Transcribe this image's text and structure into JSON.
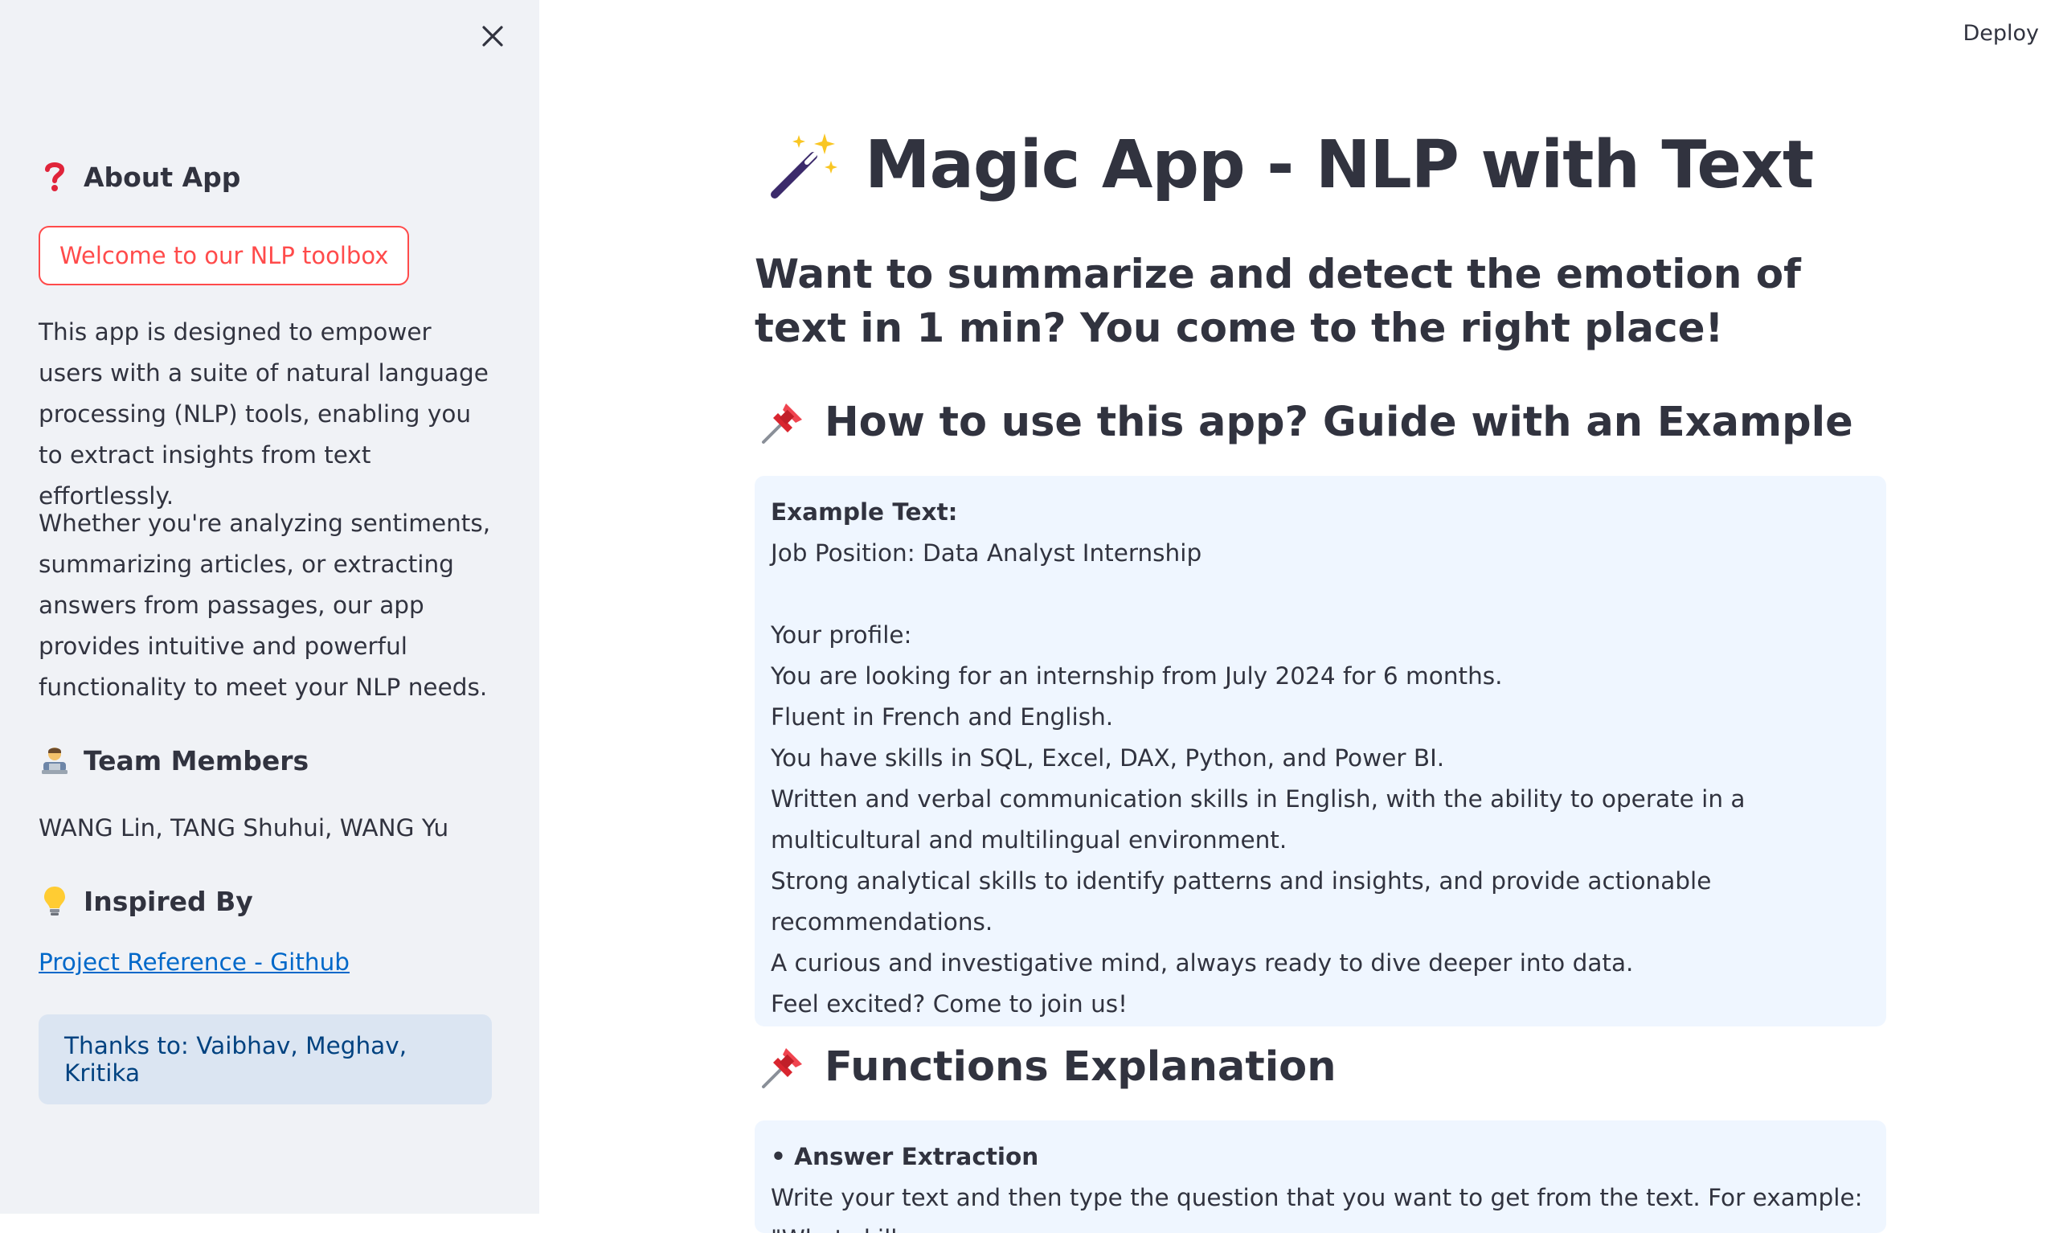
{
  "sidebar": {
    "about_heading": "About App",
    "welcome_button": "Welcome to our NLP toolbox",
    "about_paragraphs": [
      "This app is designed to empower users with a suite of natural language processing (NLP) tools, enabling you to extract insights from text effortlessly.",
      "Whether you're analyzing sentiments, summarizing articles, or extracting answers from passages, our app provides intuitive and powerful functionality to meet your NLP needs."
    ],
    "team_heading": "Team Members",
    "team_members": "WANG Lin, TANG Shuhui, WANG Yu",
    "inspired_heading": "Inspired By",
    "reference_link": "Project Reference - Github",
    "thanks": "Thanks to: Vaibhav, Meghav, Kritika"
  },
  "header": {
    "deploy_label": "Deploy"
  },
  "main": {
    "title": "Magic App - NLP with Text",
    "subtitle": "Want to summarize and detect the emotion of text in 1 min? You come to the right place!",
    "guide_heading": "How to use this app? Guide with an Example",
    "example": {
      "label": "Example Text:",
      "lines": [
        "Job Position: Data Analyst Internship",
        "",
        "Your profile:",
        "You are looking for an internship from July 2024 for 6 months.",
        "Fluent in French and English.",
        "You have skills in SQL, Excel, DAX, Python, and Power BI.",
        "Written and verbal communication skills in English, with the ability to operate in a multicultural and multilingual environment.",
        "Strong analytical skills to identify patterns and insights, and provide actionable recommendations.",
        "A curious and investigative mind, always ready to dive deeper into data.",
        "Feel excited? Come to join us!"
      ]
    },
    "functions_heading": "Functions Explanation",
    "functions": {
      "item_title": "• Answer Extraction",
      "item_text": "Write your text and then type the question that you want to get from the text. For example: \"What skills"
    }
  },
  "icons": {
    "close": "close-icon",
    "about": "question-mark-icon",
    "team": "technologist-icon",
    "inspired": "light-bulb-icon",
    "title": "magic-wand-icon",
    "section": "pushpin-icon"
  },
  "colors": {
    "sidebar_bg": "#f0f2f6",
    "accent": "#ff4b4b",
    "link": "#0068c9",
    "info_bg": "#eff6ff",
    "thanks_bg": "#dbe5f2",
    "text": "#31333f"
  }
}
